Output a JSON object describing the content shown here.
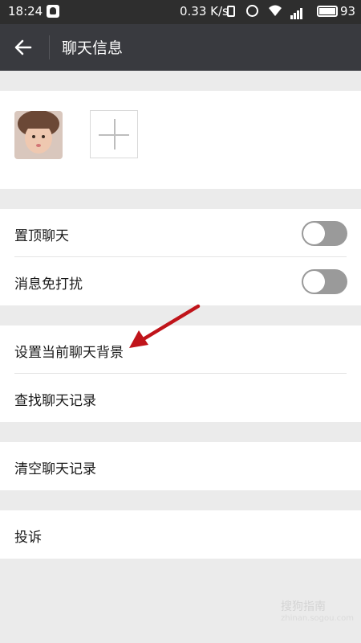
{
  "status_bar": {
    "time": "18:24",
    "speed": "0.33 K/s",
    "battery": "93"
  },
  "header": {
    "title": "聊天信息"
  },
  "settings": {
    "pin_chat": "置顶聊天",
    "mute": "消息免打扰",
    "set_background": "设置当前聊天背景",
    "search_history": "查找聊天记录",
    "clear_history": "清空聊天记录",
    "report": "投诉"
  },
  "toggles": {
    "pin_chat_on": false,
    "mute_on": false
  },
  "watermark": {
    "text": "搜狗指南",
    "sub": "zhinan.sogou.com"
  },
  "colors": {
    "title_bar": "#393a3f",
    "status_bar": "#2e2e2e",
    "toggle_off": "#9a9a9a",
    "annotation_arrow": "#c0141a"
  }
}
